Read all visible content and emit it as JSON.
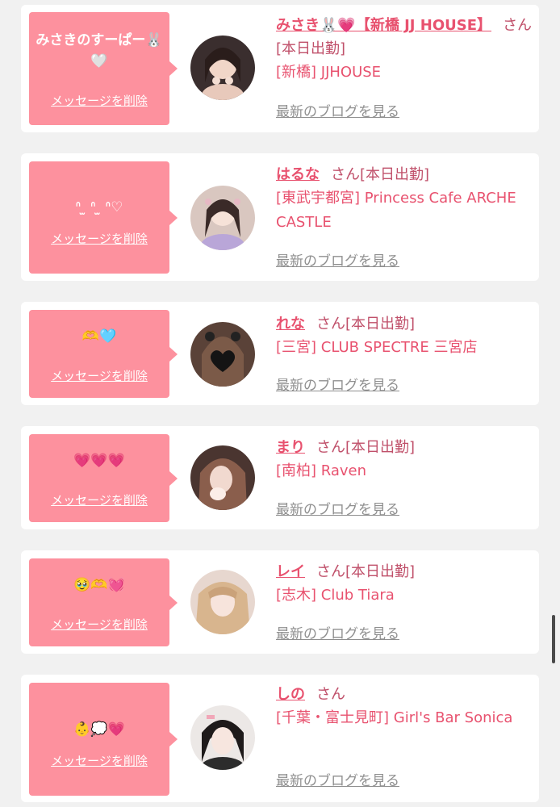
{
  "delete_label": "メッセージを削除",
  "blog_label": "最新のブログを見る",
  "san_label": "さん",
  "colors": {
    "accent_pink": "#fd919e",
    "name_pink": "#e8526f",
    "muted_gray": "#8f8f8f",
    "background": "#f1f1f1"
  },
  "items": [
    {
      "message": "みさきのすーぱー🐰🤍",
      "name": "みさき🐰💗【新橋 JJ HOUSE】",
      "san": "さん",
      "status": "[本日出勤]",
      "shop": "[新橋] JJHOUSE"
    },
    {
      "message": "ᐢ ̫ ᐢ ̫ ᐢ♡",
      "name": "はるな",
      "san": "さん",
      "status": "[本日出勤]",
      "shop": "[東武宇都宮] Princess Cafe ARCHE CASTLE"
    },
    {
      "message": "🫶🩵",
      "name": "れな",
      "san": "さん",
      "status": "[本日出勤]",
      "shop": "[三宮] CLUB SPECTRE 三宮店"
    },
    {
      "message": "💗💗💗",
      "name": "まり",
      "san": "さん",
      "status": "[本日出勤]",
      "shop": "[南柏] Raven"
    },
    {
      "message": "🥹🫶💓",
      "name": "レイ",
      "san": "さん",
      "status": "[本日出勤]",
      "shop": "[志木] Club Tiara"
    },
    {
      "message": "👶💭💗",
      "name": "しの",
      "san": "さん",
      "status": "",
      "shop": "[千葉・富士見町] Girl's Bar Sonica"
    }
  ]
}
